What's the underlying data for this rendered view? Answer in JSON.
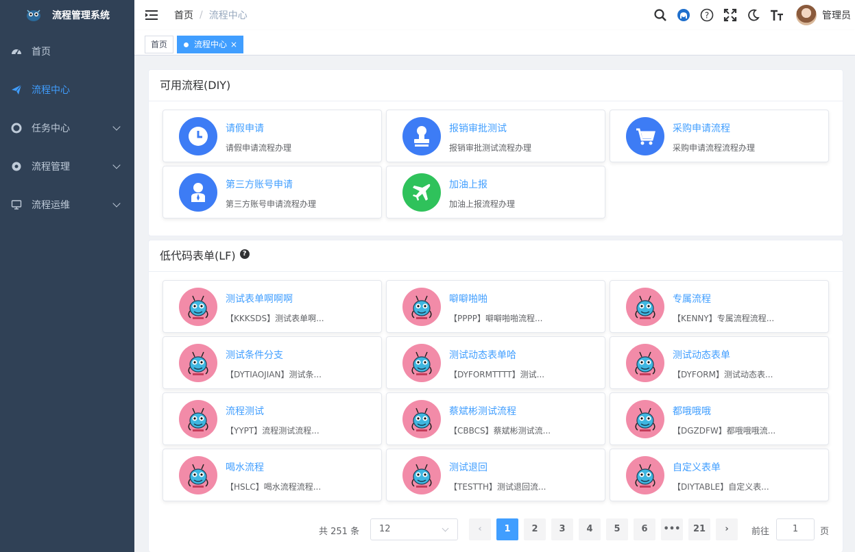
{
  "app": {
    "title": "流程管理系统"
  },
  "sidebar": {
    "items": [
      {
        "label": "首页",
        "icon": "dashboard-icon",
        "active": false,
        "expandable": false
      },
      {
        "label": "流程中心",
        "icon": "send-icon",
        "active": true,
        "expandable": false
      },
      {
        "label": "任务中心",
        "icon": "lifebuoy-icon",
        "active": false,
        "expandable": true
      },
      {
        "label": "流程管理",
        "icon": "gear-icon",
        "active": false,
        "expandable": true
      },
      {
        "label": "流程运维",
        "icon": "monitor-icon",
        "active": false,
        "expandable": true
      }
    ]
  },
  "navbar": {
    "breadcrumb": [
      "首页",
      "流程中心"
    ],
    "breadcrumb_separator": "/",
    "icons": [
      "search-icon",
      "github-icon",
      "help-circle-icon",
      "fullscreen-icon",
      "moon-icon",
      "font-size-icon"
    ],
    "user_name": "管理员"
  },
  "tags": [
    {
      "label": "首页",
      "active": false
    },
    {
      "label": "流程中心",
      "active": true,
      "close": "×"
    }
  ],
  "diy_section": {
    "title": "可用流程(DIY)",
    "items": [
      {
        "title": "请假申请",
        "desc": "请假申请流程办理",
        "icon": "clock-icon",
        "color": "#3d7cf5"
      },
      {
        "title": "报销审批测试",
        "desc": "报销审批测试流程办理",
        "icon": "stamp-icon",
        "color": "#3d7cf5"
      },
      {
        "title": "采购申请流程",
        "desc": "采购申请流程流程办理",
        "icon": "cart-icon",
        "color": "#3d7cf5"
      },
      {
        "title": "第三方账号申请",
        "desc": "第三方账号申请流程办理",
        "icon": "user-tie-icon",
        "color": "#3d7cf5"
      },
      {
        "title": "加油上报",
        "desc": "加油上报流程办理",
        "icon": "plane-icon",
        "color": "#2fc25b"
      }
    ]
  },
  "lf_section": {
    "title": "低代码表单(LF)",
    "help": "?",
    "items": [
      {
        "title": "测试表单啊啊啊",
        "desc": "【KKKSDS】测试表单啊..."
      },
      {
        "title": "噼噼啪啪",
        "desc": "【PPPP】噼噼啪啪流程..."
      },
      {
        "title": "专属流程",
        "desc": "【KENNY】专属流程流程..."
      },
      {
        "title": "测试条件分支",
        "desc": "【DYTIAOJIAN】测试条..."
      },
      {
        "title": "测试动态表单哈",
        "desc": "【DYFORMTTTT】测试..."
      },
      {
        "title": "测试动态表单",
        "desc": "【DYFORM】测试动态表..."
      },
      {
        "title": "流程测试",
        "desc": "【YYPT】流程测试流程..."
      },
      {
        "title": "蔡斌彬测试流程",
        "desc": "【CBBCS】蔡斌彬测试流..."
      },
      {
        "title": "都哦哦哦",
        "desc": "【DGZDFW】都哦哦哦流..."
      },
      {
        "title": "喝水流程",
        "desc": "【HSLC】喝水流程流程..."
      },
      {
        "title": "测试退回",
        "desc": "【TESTTH】测试退回流..."
      },
      {
        "title": "自定义表单",
        "desc": "【DIYTABLE】自定义表..."
      }
    ]
  },
  "pagination": {
    "total_text": "共 251 条",
    "page_size": "12",
    "pages": [
      "1",
      "2",
      "3",
      "4",
      "5",
      "6",
      "•••",
      "21"
    ],
    "current": "1",
    "prev": "‹",
    "next": "›",
    "goto_label": "前往",
    "goto_value": "1",
    "goto_unit": "页"
  },
  "colors": {
    "sidebar_bg": "#304156",
    "accent": "#409eff",
    "lf_icon_bg": "#f28ba8",
    "lf_bug": "#3fb6e0"
  }
}
